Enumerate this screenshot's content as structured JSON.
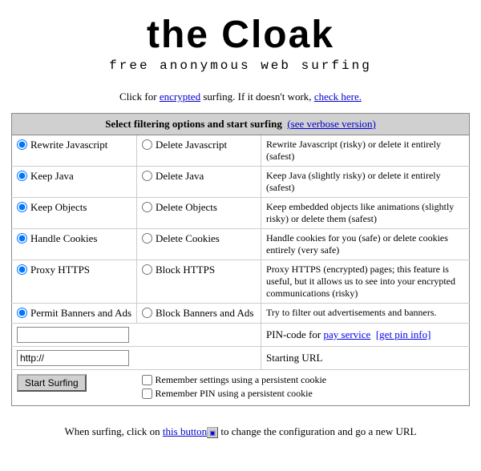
{
  "header": {
    "title": "the Cloak",
    "subtitle": "free anonymous web surfing"
  },
  "intro": {
    "text_before": "Click for ",
    "link_encrypted": "encrypted",
    "text_middle": " surfing. If it doesn't work, ",
    "link_check": "check here."
  },
  "table": {
    "header_label": "Select filtering options and start surfing",
    "header_link": "(see verbose version)",
    "rows": [
      {
        "opt1_label": "Rewrite Javascript",
        "opt2_label": "Delete Javascript",
        "desc": "Rewrite Javascript (risky) or delete it entirely (safest)"
      },
      {
        "opt1_label": "Keep Java",
        "opt2_label": "Delete Java",
        "desc": "Keep Java (slightly risky) or delete it entirely (safest)"
      },
      {
        "opt1_label": "Keep Objects",
        "opt2_label": "Delete Objects",
        "desc": "Keep embedded objects like animations (slightly risky) or delete them (safest)"
      },
      {
        "opt1_label": "Handle Cookies",
        "opt2_label": "Delete Cookies",
        "desc": "Handle cookies for you (safe) or delete cookies entirely (very safe)"
      },
      {
        "opt1_label": "Proxy HTTPS",
        "opt2_label": "Block HTTPS",
        "desc": "Proxy HTTPS (encrypted) pages; this feature is useful, but it allows us to see into your encrypted communications (risky)"
      },
      {
        "opt1_label": "Permit Banners and Ads",
        "opt2_label": "Block Banners and Ads",
        "desc": "Try to filter out advertisements and banners."
      }
    ],
    "pin_label": "PIN-code for ",
    "pin_link_pay": "pay service",
    "pin_link_getpin": "[get pin info]",
    "url_label": "Starting URL",
    "url_value": "http://",
    "start_button": "Start Surfing",
    "checkbox1": "Remember settings using a persistent cookie",
    "checkbox2": "Remember PIN using a persistent cookie"
  },
  "footer": {
    "text_before": "When surfing, click on ",
    "link_label": "this button",
    "text_after": " to change the configuration and go a new URL"
  }
}
